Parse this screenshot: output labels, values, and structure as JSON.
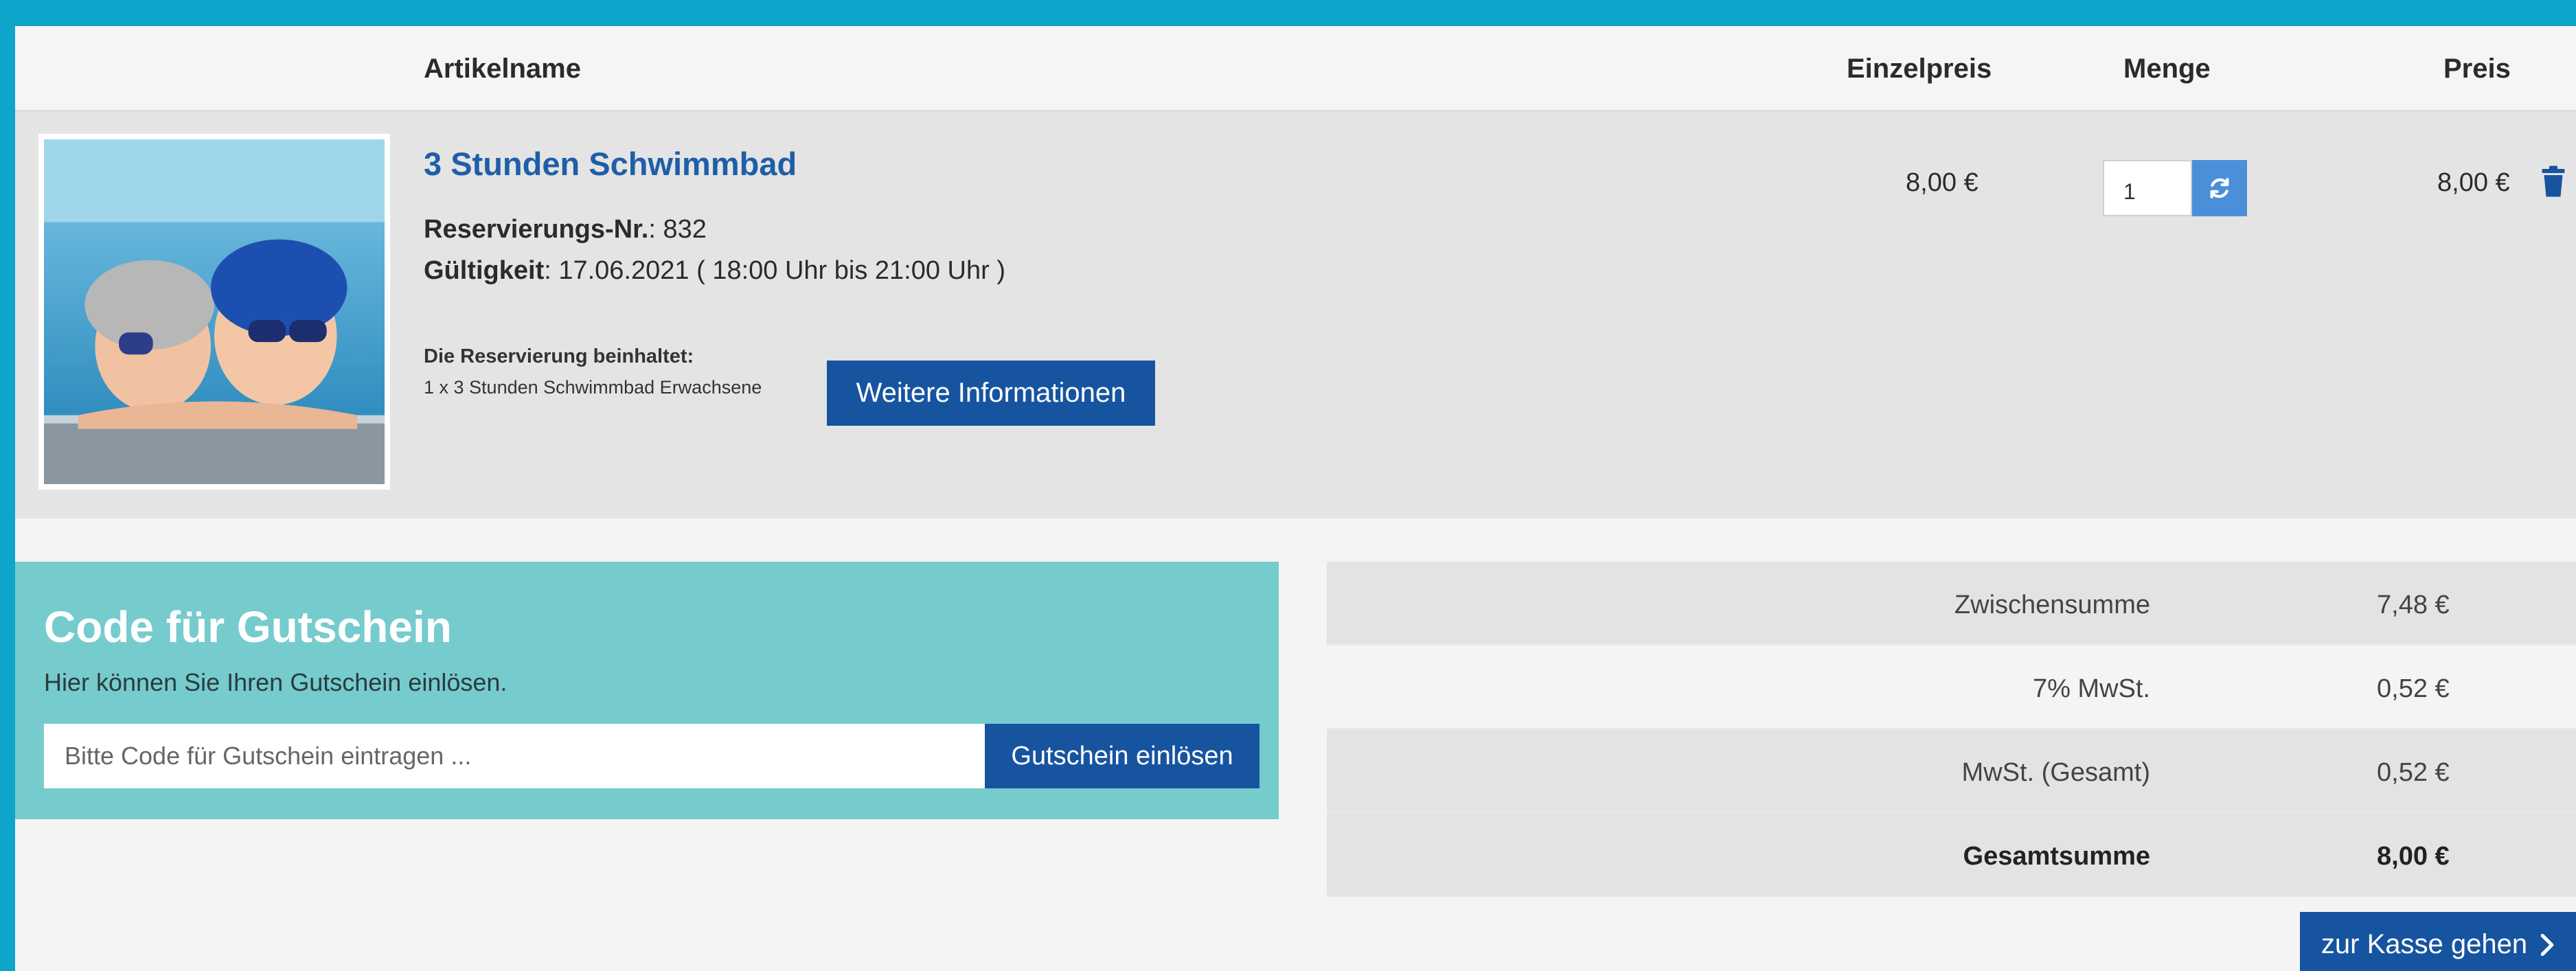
{
  "table_header": {
    "article_name": "Artikelname",
    "unit_price": "Einzelpreis",
    "quantity": "Menge",
    "price": "Preis"
  },
  "item": {
    "title": "3 Stunden Schwimmbad",
    "reservation_label": "Reservierungs-Nr.",
    "reservation_value": ": 832",
    "validity_label": "Gültigkeit",
    "validity_value": ": 17.06.2021 ( 18:00 Uhr bis 21:00 Uhr )",
    "includes_heading": "Die Reservierung beinhaltet:",
    "includes_item": "1 x 3 Stunden Schwimmbad Erwachsene",
    "more_info_button": "Weitere Informationen",
    "unit_price": "8,00 €",
    "quantity": "1",
    "line_price": "8,00 €",
    "image": "children-in-swimming-pool-photo"
  },
  "voucher": {
    "title": "Code für Gutschein",
    "subtitle": "Hier können Sie Ihren Gutschein einlösen.",
    "placeholder": "Bitte Code für Gutschein eintragen ...",
    "button": "Gutschein einlösen"
  },
  "totals": [
    {
      "label": "Zwischensumme",
      "value": "7,48 €"
    },
    {
      "label": "7% MwSt.",
      "value": "0,52 €"
    },
    {
      "label": "MwSt. (Gesamt)",
      "value": "0,52 €"
    },
    {
      "label": "Gesamtsumme",
      "value": "8,00 €"
    }
  ],
  "checkout_button": "zur Kasse gehen",
  "icons": {
    "refresh": "refresh-icon",
    "delete": "trash-icon",
    "checkout_arrow": "chevron-right-icon"
  },
  "colors": {
    "frame": "#0da5c9",
    "primary_button": "#1754a0",
    "title_link": "#1f5ea8",
    "voucher_panel": "#76cbcd",
    "refresh_button": "#4a90d9"
  }
}
